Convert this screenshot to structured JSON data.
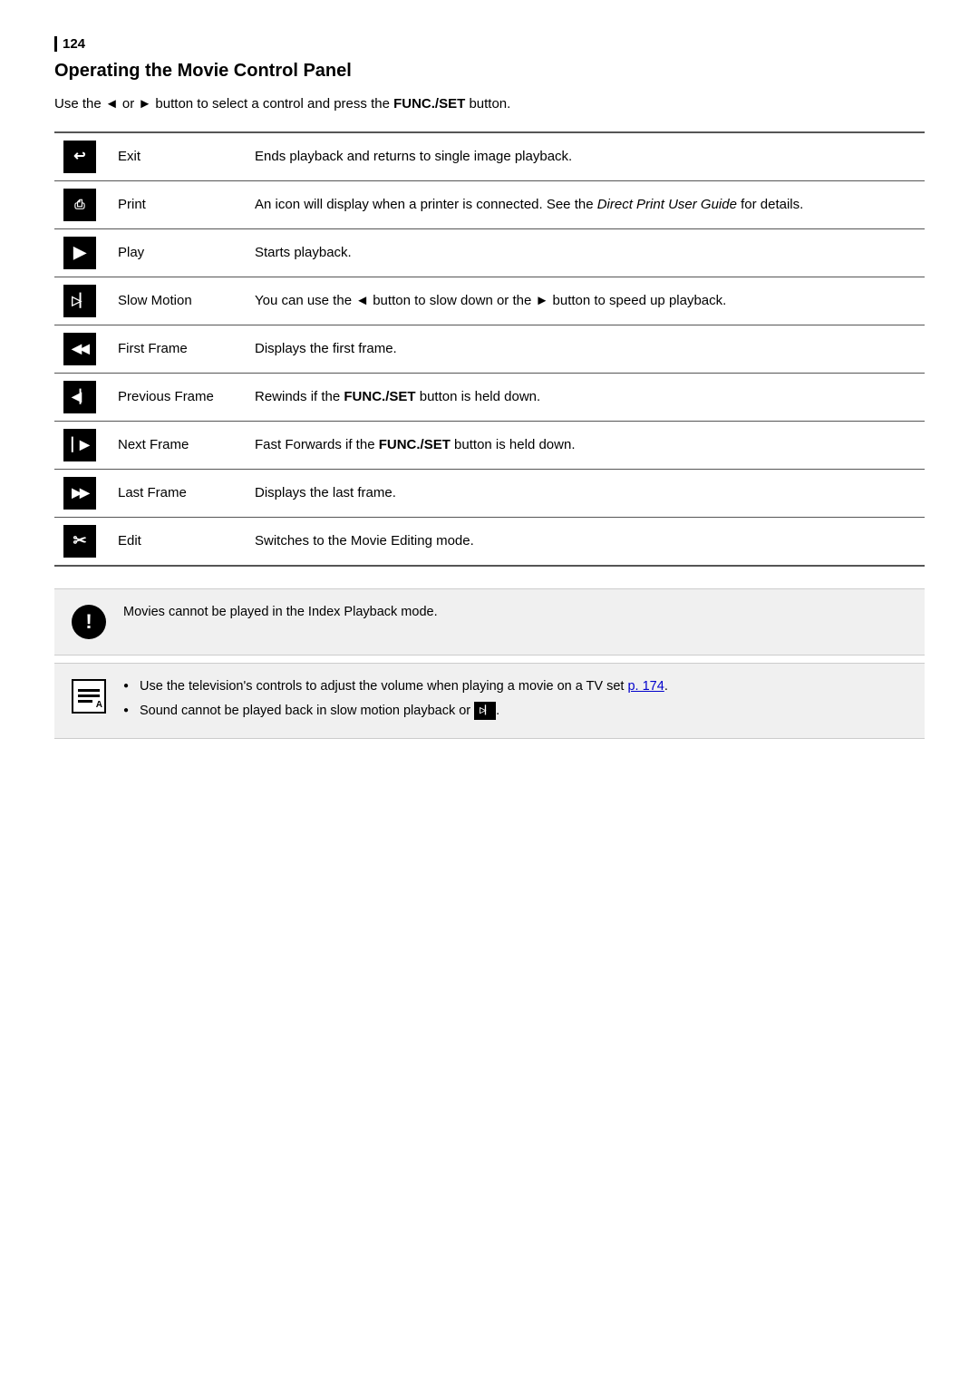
{
  "page": {
    "number": "124",
    "section_title": "Operating the Movie Control Panel",
    "intro": {
      "text_before": "Use the",
      "arrow_left": "◀",
      "connector": "or",
      "arrow_right": "▶",
      "text_after": "button to select a control and press the",
      "func_set": "FUNC./SET",
      "text_end": "button."
    },
    "table": {
      "rows": [
        {
          "icon_symbol": "↩",
          "icon_label": "exit-icon",
          "name": "Exit",
          "description": "Ends playback and returns to single image playback."
        },
        {
          "icon_symbol": "⎙",
          "icon_label": "print-icon",
          "name": "Print",
          "description": "An icon will display when a printer is connected. See the <i>Direct Print User Guide</i> for details."
        },
        {
          "icon_symbol": "▶",
          "icon_label": "play-icon",
          "name": "Play",
          "description": "Starts playback."
        },
        {
          "icon_symbol": "▷",
          "icon_label": "slow-motion-icon",
          "name": "Slow Motion",
          "description_before": "You can use the",
          "arrow_left": "◀",
          "description_mid": "button to slow down or the",
          "arrow_right": "▶",
          "description_after": "button to speed up playback."
        },
        {
          "icon_symbol": "⏮",
          "icon_label": "first-frame-icon",
          "name": "First Frame",
          "description": "Displays the first frame."
        },
        {
          "icon_symbol": "⏪",
          "icon_label": "previous-frame-icon",
          "name": "Previous Frame",
          "description_before": "Rewinds if the",
          "func_set": "FUNC./SET",
          "description_after": "button is held down."
        },
        {
          "icon_symbol": "⏩",
          "icon_label": "next-frame-icon",
          "name": "Next Frame",
          "description_before": "Fast Forwards if the",
          "func_set": "FUNC./SET",
          "description_after": "button is held down."
        },
        {
          "icon_symbol": "⏭",
          "icon_label": "last-frame-icon",
          "name": "Last Frame",
          "description": "Displays the last frame."
        },
        {
          "icon_symbol": "✂",
          "icon_label": "edit-icon",
          "name": "Edit",
          "description": "Switches to the Movie Editing mode."
        }
      ]
    },
    "notices": [
      {
        "type": "warning",
        "icon_label": "warning-icon",
        "text": "Movies cannot be played in the Index Playback mode."
      },
      {
        "type": "note",
        "icon_label": "note-icon",
        "items": [
          {
            "text_before": "Use the television's controls to adjust the volume when playing a movie on a TV set",
            "link_text": "p. 174",
            "text_after": "."
          },
          {
            "text": "Sound cannot be played back in slow motion playback or"
          }
        ]
      }
    ]
  }
}
